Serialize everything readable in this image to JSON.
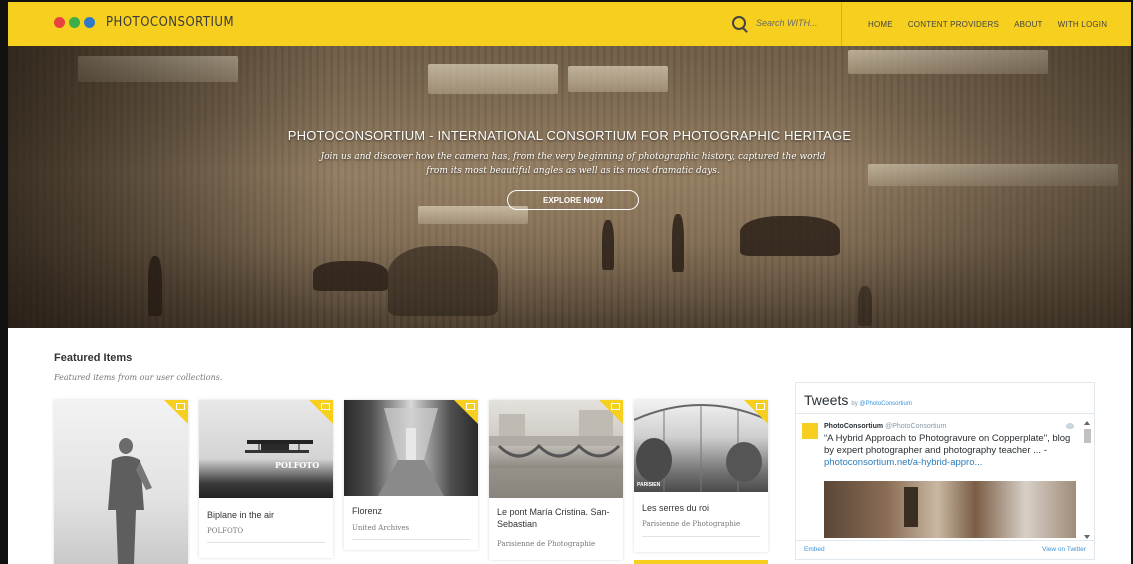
{
  "header": {
    "logo_text": "PHOTOCONSORTIUM",
    "logo_dots": [
      "#e8423f",
      "#3fae49",
      "#2f79c6"
    ],
    "search_placeholder": "Search WITH...",
    "nav": [
      "HOME",
      "CONTENT PROVIDERS",
      "ABOUT",
      "WITH LOGIN"
    ],
    "bar_color": "#f7cf1e"
  },
  "hero": {
    "title": "PHOTOCONSORTIUM - INTERNATIONAL CONSORTIUM FOR PHOTOGRAPHIC HERITAGE",
    "subtitle": "Join us and discover how the camera has, from the very beginning of photographic history, captured the world from its most beautiful angles as well as its most dramatic days.",
    "button": "EXPLORE NOW"
  },
  "featured": {
    "title": "Featured Items",
    "subtitle": "Featured items from our user collections.",
    "cards": [
      {
        "title": "Biplane in the air",
        "source": "POLFOTO"
      },
      {
        "title": "Florenz",
        "source": "United Archives"
      },
      {
        "title": "Le pont María Cristina. San-Sebastian",
        "source": "Parisienne de Photographie"
      },
      {
        "title": "Les serres du roi",
        "source": "Parisienne de Photographie"
      }
    ],
    "thumb_captions": {
      "polfoto": "POLFOTO",
      "parisien": "PARISIEN"
    }
  },
  "tweets": {
    "title": "Tweets",
    "by": "by",
    "by_handle": "@PhotoConsortium",
    "author": "PhotoConsortium",
    "author_handle": "@PhotoConsortium",
    "text": "“A Hybrid Approach to Photogravure on Copperplate\", blog by expert photographer and photography teacher ... -",
    "link": "photoconsortium.net/a-hybrid-appro...",
    "embed": "Embed",
    "view_on": "View on Twitter"
  }
}
